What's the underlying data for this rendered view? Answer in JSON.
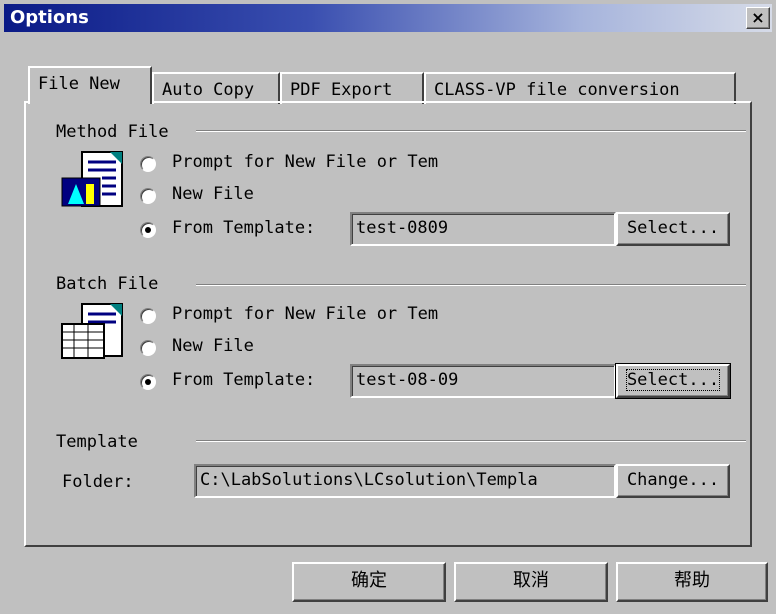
{
  "window": {
    "title": "Options",
    "close": "×"
  },
  "tabs": [
    {
      "label": "File New"
    },
    {
      "label": "Auto Copy"
    },
    {
      "label": "PDF Export"
    },
    {
      "label": "CLASS-VP file conversion"
    }
  ],
  "method_file": {
    "group_label": "Method File",
    "options": [
      "Prompt for New File or Tem",
      "New File",
      "From Template:"
    ],
    "selected": 2,
    "template_value": "test-0809",
    "select_label": "Select..."
  },
  "batch_file": {
    "group_label": "Batch File",
    "options": [
      "Prompt for New File or Tem",
      "New File",
      "From Template:"
    ],
    "selected": 2,
    "template_value": "test-08-09",
    "select_label": "Select..."
  },
  "template": {
    "group_label": "Template",
    "folder_label": "Folder:",
    "folder_value": "C:\\LabSolutions\\LCsolution\\Templa",
    "change_label": "Change..."
  },
  "footer": {
    "ok": "确定",
    "cancel": "取消",
    "help": "帮助"
  }
}
